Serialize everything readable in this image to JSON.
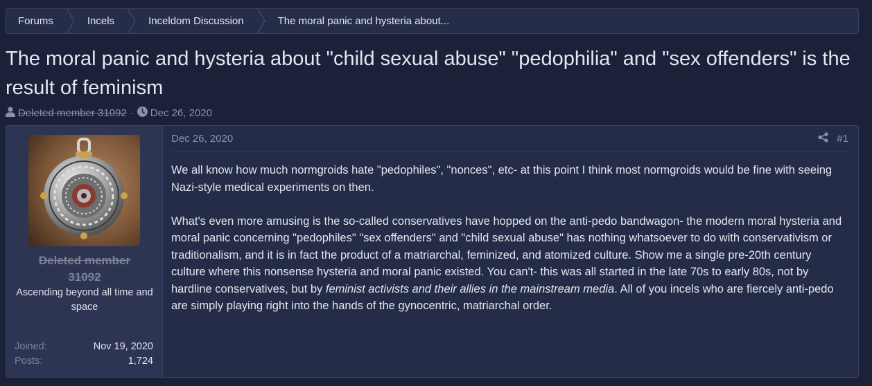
{
  "breadcrumb": {
    "items": [
      "Forums",
      "Incels",
      "Inceldom Discussion",
      "The moral panic and hysteria about..."
    ]
  },
  "thread": {
    "title": "The moral panic and hysteria about \"child sexual abuse\" \"pedophilia\" and \"sex offenders\" is the result of feminism",
    "author": "Deleted member 31092",
    "date": "Dec 26, 2020",
    "meta_sep": "·"
  },
  "post": {
    "user": {
      "name": "Deleted member 31092",
      "title": "Ascending beyond all time and space",
      "joined_label": "Joined:",
      "joined_value": "Nov 19, 2020",
      "posts_label": "Posts:",
      "posts_value": "1,724",
      "avatar_icon": "medallion-avatar"
    },
    "date": "Dec 26, 2020",
    "number": "#1",
    "share_icon": "share-icon",
    "paragraph1": "We all know how much normgroids hate \"pedophiles\", \"nonces\", etc- at this point I think most normgroids would be fine with seeing Nazi-style medical experiments on then.",
    "paragraph2_a": "What's even more amusing is the so-called conservatives have hopped on the anti-pedo bandwagon- the modern moral hysteria and moral panic concerning \"pedophiles\" \"sex offenders\" and \"child sexual abuse\" has nothing whatsoever to do with conservativism or traditionalism, and it is in fact the product of a matriarchal, feminized, and atomized culture. Show me a single pre-20th century culture where this nonsense hysteria and moral panic existed. You can't- this was all started in the late 70s to early 80s, not by hardline conservatives, but by ",
    "paragraph2_em": "feminist activists and their allies in the mainstream media",
    "paragraph2_b": ". All of you incels who are fiercely anti-pedo are simply playing right into the hands of the gynocentric, matriarchal order."
  },
  "colors": {
    "background": "#1b2138",
    "panel": "#252c47",
    "user_panel": "#2d3553",
    "border": "#3a4262",
    "muted_text": "#8a91aa"
  }
}
